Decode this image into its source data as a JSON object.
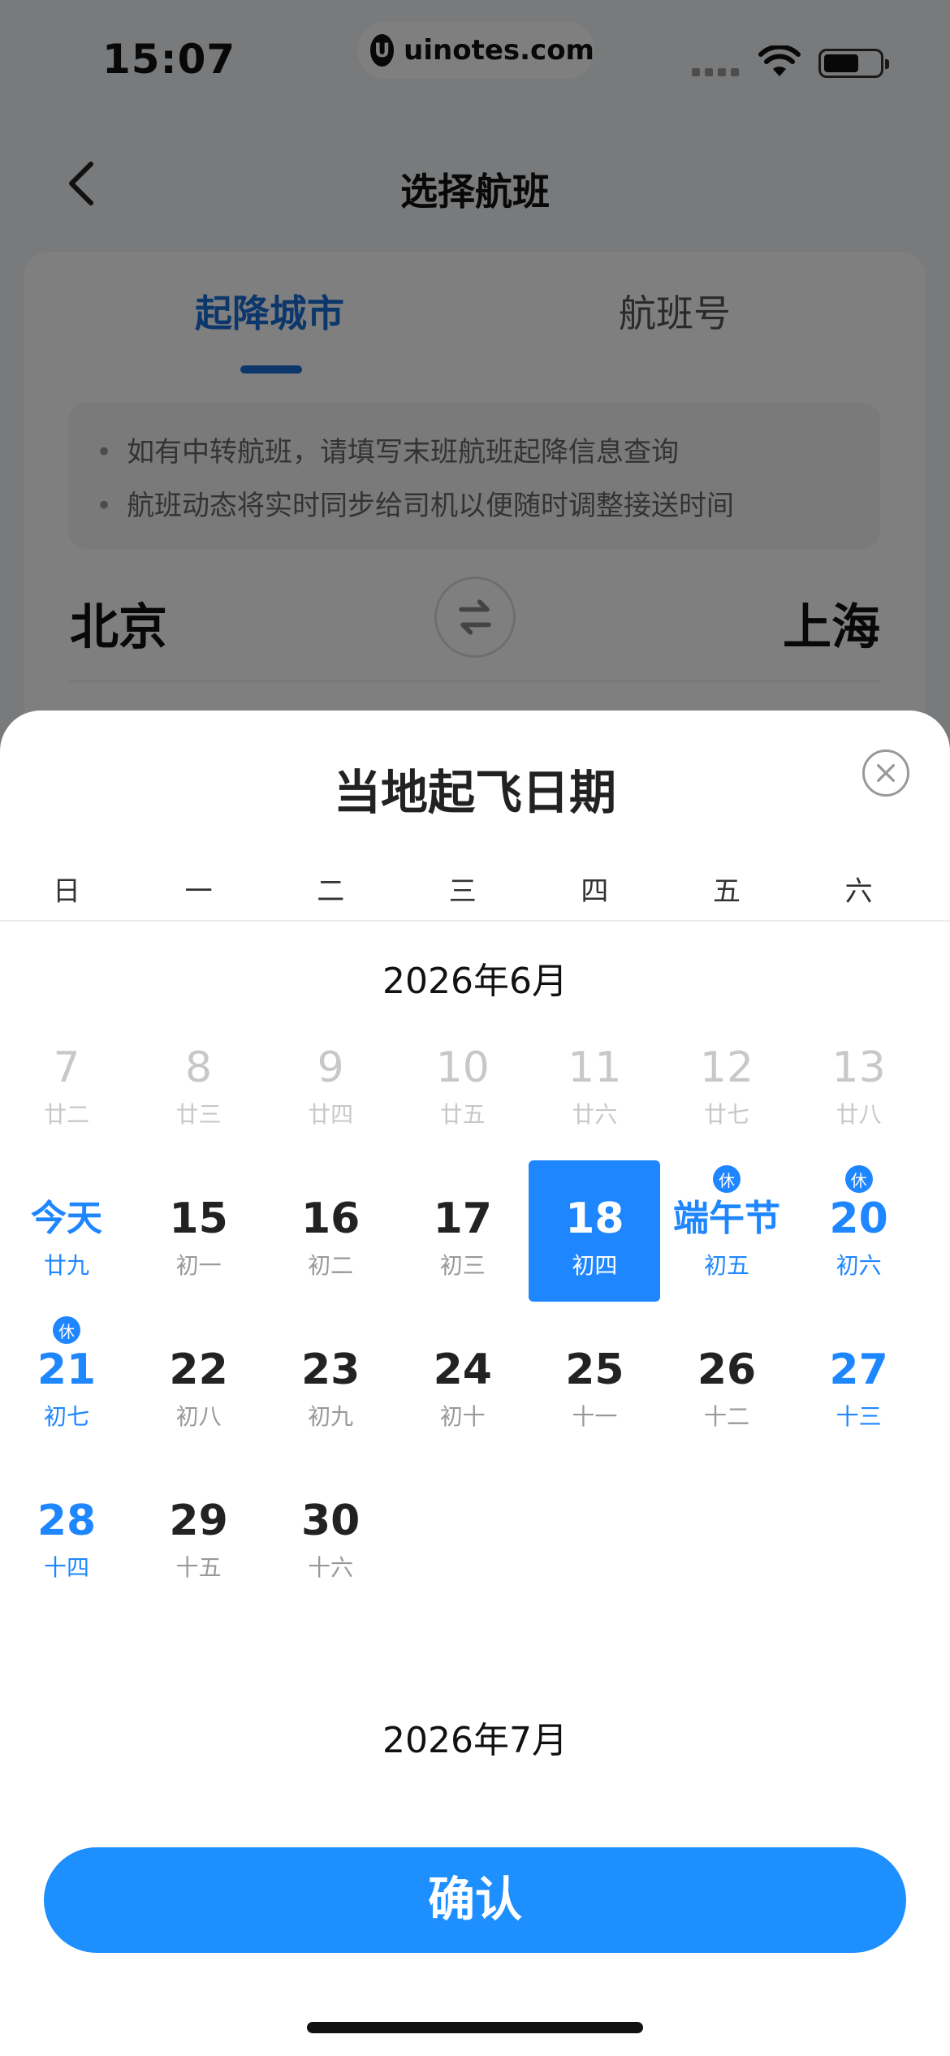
{
  "status_bar": {
    "time": "15:07",
    "url": "uinotes.com",
    "url_logo": "U"
  },
  "nav": {
    "title": "选择航班"
  },
  "tabs": [
    {
      "label": "起降城市",
      "active": true
    },
    {
      "label": "航班号",
      "active": false
    }
  ],
  "notice": [
    "如有中转航班，请填写末班航班起降信息查询",
    "航班动态将实时同步给司机以便随时调整接送时间"
  ],
  "route": {
    "from": "北京",
    "to": "上海"
  },
  "sheet": {
    "title": "当地起飞日期",
    "weekdays": [
      "日",
      "一",
      "二",
      "三",
      "四",
      "五",
      "六"
    ],
    "months": [
      {
        "title": "2026年6月",
        "weeks": [
          [
            {
              "num": "7",
              "lunar": "廿二",
              "state": "past"
            },
            {
              "num": "8",
              "lunar": "廿三",
              "state": "past"
            },
            {
              "num": "9",
              "lunar": "廿四",
              "state": "past"
            },
            {
              "num": "10",
              "lunar": "廿五",
              "state": "past"
            },
            {
              "num": "11",
              "lunar": "廿六",
              "state": "past"
            },
            {
              "num": "12",
              "lunar": "廿七",
              "state": "past"
            },
            {
              "num": "13",
              "lunar": "廿八",
              "state": "past"
            }
          ],
          [
            {
              "num": "今天",
              "lunar": "廿九",
              "state": "today"
            },
            {
              "num": "15",
              "lunar": "初一",
              "state": "normal"
            },
            {
              "num": "16",
              "lunar": "初二",
              "state": "normal"
            },
            {
              "num": "17",
              "lunar": "初三",
              "state": "normal"
            },
            {
              "num": "18",
              "lunar": "初四",
              "state": "selected"
            },
            {
              "num": "端午节",
              "lunar": "初五",
              "state": "holiday",
              "badge": "休"
            },
            {
              "num": "20",
              "lunar": "初六",
              "state": "weekend",
              "badge": "休"
            }
          ],
          [
            {
              "num": "21",
              "lunar": "初七",
              "state": "weekend",
              "badge": "休"
            },
            {
              "num": "22",
              "lunar": "初八",
              "state": "normal"
            },
            {
              "num": "23",
              "lunar": "初九",
              "state": "normal"
            },
            {
              "num": "24",
              "lunar": "初十",
              "state": "normal"
            },
            {
              "num": "25",
              "lunar": "十一",
              "state": "normal"
            },
            {
              "num": "26",
              "lunar": "十二",
              "state": "normal"
            },
            {
              "num": "27",
              "lunar": "十三",
              "state": "weekend"
            }
          ],
          [
            {
              "num": "28",
              "lunar": "十四",
              "state": "weekend"
            },
            {
              "num": "29",
              "lunar": "十五",
              "state": "normal"
            },
            {
              "num": "30",
              "lunar": "十六",
              "state": "normal"
            }
          ]
        ]
      },
      {
        "title": "2026年7月",
        "weeks": []
      }
    ],
    "confirm_label": "确认"
  },
  "colors": {
    "accent": "#1e86ff",
    "tab_active": "#1a6fd6",
    "past_text": "#c8c8c8"
  },
  "icons": [
    "back-icon",
    "wifi-icon",
    "battery-icon",
    "swap-icon",
    "close-icon"
  ]
}
